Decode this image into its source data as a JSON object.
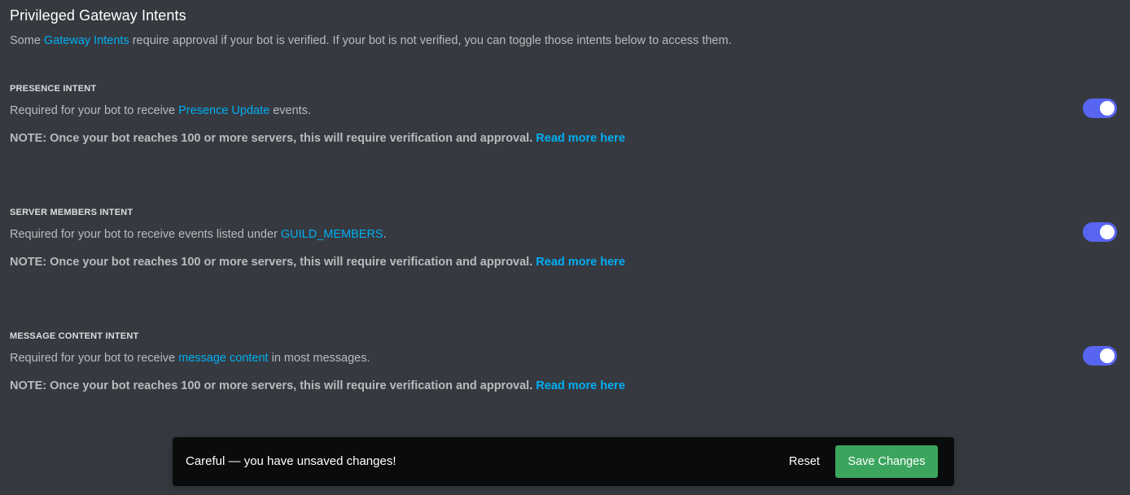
{
  "header": {
    "title": "Privileged Gateway Intents",
    "desc_prefix": "Some ",
    "desc_link": "Gateway Intents",
    "desc_suffix": " require approval if your bot is verified. If your bot is not verified, you can toggle those intents below to access them."
  },
  "intents": [
    {
      "title": "PRESENCE INTENT",
      "desc_prefix": "Required for your bot to receive ",
      "desc_link": "Presence Update",
      "desc_suffix": " events.",
      "note": "NOTE: Once your bot reaches 100 or more servers, this will require verification and approval. ",
      "note_link": "Read more here",
      "enabled": true
    },
    {
      "title": "SERVER MEMBERS INTENT",
      "desc_prefix": "Required for your bot to receive events listed under ",
      "desc_link": "GUILD_MEMBERS",
      "desc_suffix": ".",
      "note": "NOTE: Once your bot reaches 100 or more servers, this will require verification and approval. ",
      "note_link": "Read more here",
      "enabled": true
    },
    {
      "title": "MESSAGE CONTENT INTENT",
      "desc_prefix": "Required for your bot to receive ",
      "desc_link": "message content",
      "desc_suffix": " in most messages.",
      "note": "NOTE: Once your bot reaches 100 or more servers, this will require verification and approval. ",
      "note_link": "Read more here",
      "enabled": true
    }
  ],
  "unsaved_bar": {
    "message": "Careful — you have unsaved changes!",
    "reset_label": "Reset",
    "save_label": "Save Changes"
  },
  "colors": {
    "background": "#36393f",
    "link": "#00aff4",
    "toggle_on": "#5865f2",
    "save_button": "#3ba55d",
    "bar_background": "#0a0b0c"
  }
}
